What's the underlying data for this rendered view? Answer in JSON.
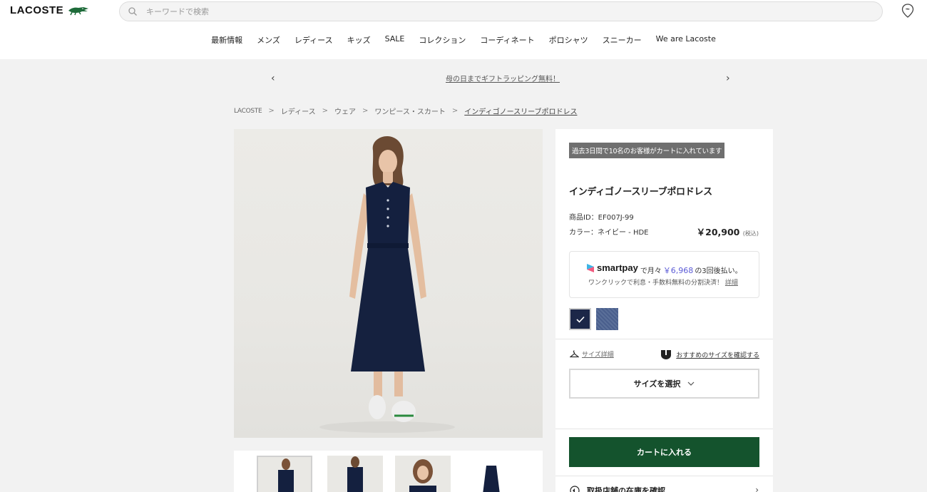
{
  "header": {
    "logo_text": "LACOSTE",
    "search_placeholder": "キーワードで検索"
  },
  "nav": {
    "items": [
      "最新情報",
      "メンズ",
      "レディース",
      "キッズ",
      "SALE",
      "コレクション",
      "コーディネート",
      "ポロシャツ",
      "スニーカー",
      "We are Lacoste"
    ]
  },
  "promo": {
    "text": "母の日までギフトラッピング無料！",
    "prev": "‹",
    "next": "›"
  },
  "breadcrumb": {
    "items": [
      "LACOSTE",
      "レディース",
      "ウェア",
      "ワンピース・スカート",
      "インディゴノースリーブポロドレス"
    ],
    "separator": ">"
  },
  "product": {
    "badge": "過去3日間で10名のお客様がカートに入れています",
    "title": "インディゴノースリーブポロドレス",
    "id_label": "商品ID：EF007J-99",
    "color_label": "カラー：ネイビー - HDE",
    "price": "￥20,900",
    "price_tax": "(税込)",
    "colors": {
      "selected": "#1c2748",
      "alt": "#5a6f99"
    }
  },
  "smartpay": {
    "logo": "smartpay",
    "prefix": "で月々",
    "amount": "￥6,968",
    "suffix": "の3回後払い。",
    "sub": "ワンクリックで利息・手数料無料の分割決済！",
    "link": "詳細"
  },
  "size": {
    "guide": "サイズ詳細",
    "recommend": "おすすめのサイズを確認する",
    "select": "サイズを選択"
  },
  "actions": {
    "cart": "カートに入れる",
    "store": "取扱店舗の在庫を確認",
    "cart_color": "#14532d"
  }
}
